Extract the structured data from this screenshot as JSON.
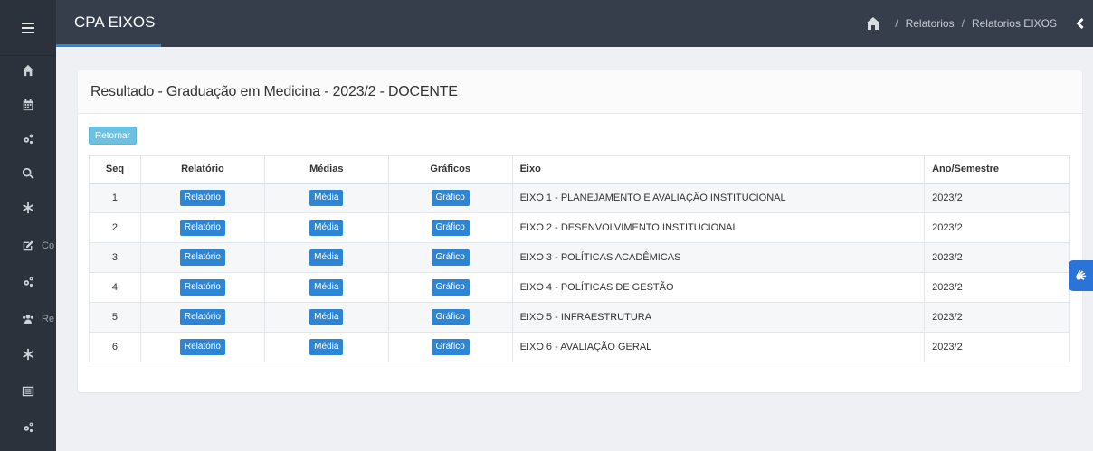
{
  "app": {
    "title": "CPA EIXOS"
  },
  "breadcrumb": {
    "items": [
      "Relatorios",
      "Relatorios EIXOS"
    ],
    "separator": "/"
  },
  "sidebar": {
    "items": [
      {
        "icon": "home-icon",
        "label": ""
      },
      {
        "icon": "calendar-icon",
        "label": ""
      },
      {
        "icon": "gears-icon",
        "label": ""
      },
      {
        "icon": "search-icon",
        "label": ""
      },
      {
        "icon": "asterisk-icon",
        "label": ""
      },
      {
        "icon": "edit-icon",
        "label": "Co"
      },
      {
        "icon": "gears-icon",
        "label": ""
      },
      {
        "icon": "users-icon",
        "label": "Re"
      },
      {
        "icon": "asterisk-icon",
        "label": ""
      },
      {
        "icon": "list-icon",
        "label": ""
      },
      {
        "icon": "gears-icon",
        "label": ""
      }
    ]
  },
  "page": {
    "title": "Resultado - Graduação em Medicina - 2023/2 - DOCENTE",
    "return_label": "Retornar"
  },
  "table": {
    "headers": {
      "seq": "Seq",
      "relatorio": "Relatório",
      "medias": "Médias",
      "graficos": "Gráficos",
      "eixo": "Eixo",
      "ano": "Ano/Semestre"
    },
    "button_labels": {
      "relatorio": "Relatório",
      "media": "Média",
      "grafico": "Gráfico"
    },
    "rows": [
      {
        "seq": "1",
        "eixo": "EIXO 1 - PLANEJAMENTO E AVALIAÇÃO INSTITUCIONAL",
        "ano": "2023/2"
      },
      {
        "seq": "2",
        "eixo": "EIXO 2 - DESENVOLVIMENTO INSTITUCIONAL",
        "ano": "2023/2"
      },
      {
        "seq": "3",
        "eixo": "EIXO 3 - POLÍTICAS ACADÊMICAS",
        "ano": "2023/2"
      },
      {
        "seq": "4",
        "eixo": "EIXO 4 - POLÍTICAS DE GESTÃO",
        "ano": "2023/2"
      },
      {
        "seq": "5",
        "eixo": "EIXO 5 - INFRAESTRUTURA",
        "ano": "2023/2"
      },
      {
        "seq": "6",
        "eixo": "EIXO 6 - AVALIAÇÃO GERAL",
        "ano": "2023/2"
      }
    ]
  },
  "colors": {
    "sidebar": "#2b323b",
    "topbar": "#353e4a",
    "accent": "#2d85d4",
    "return_button": "#6cc0e0",
    "access_widget": "#2a73d9"
  }
}
